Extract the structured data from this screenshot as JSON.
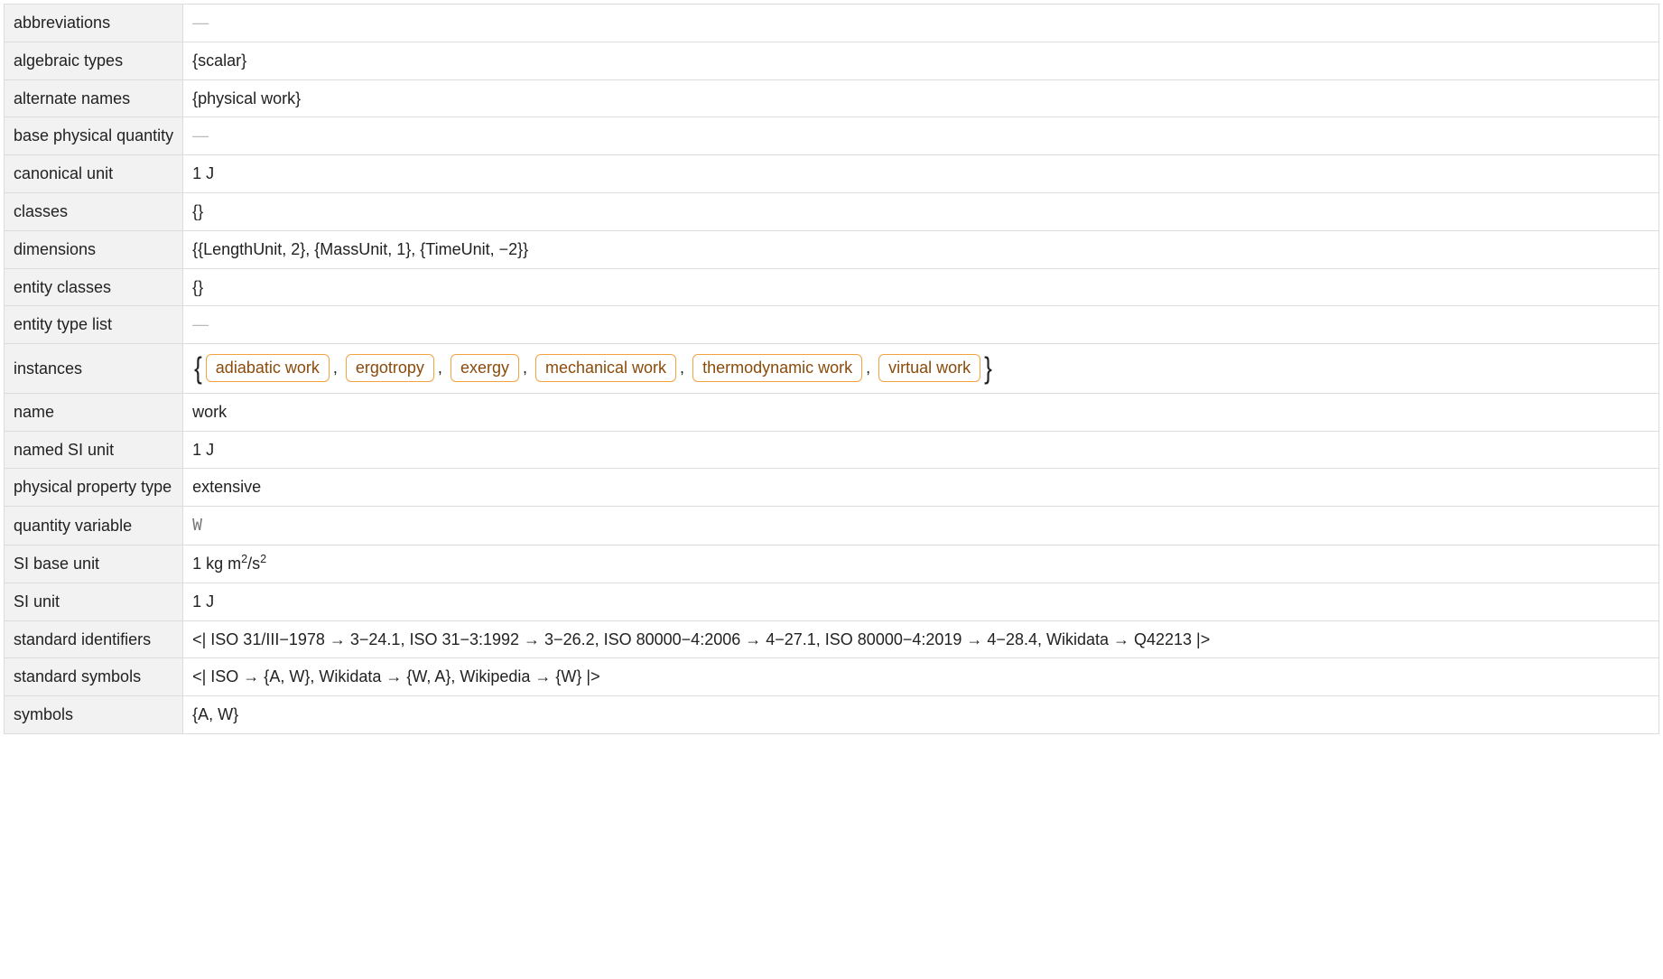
{
  "rows": [
    {
      "label": "abbreviations",
      "type": "missing"
    },
    {
      "label": "algebraic types",
      "type": "text",
      "value": "{scalar}"
    },
    {
      "label": "alternate names",
      "type": "text",
      "value": "{physical work}"
    },
    {
      "label": "base physical quantity",
      "type": "missing"
    },
    {
      "label": "canonical unit",
      "type": "text",
      "value": "1 J"
    },
    {
      "label": "classes",
      "type": "text",
      "value": "{}"
    },
    {
      "label": "dimensions",
      "type": "text",
      "value": "{{LengthUnit, 2}, {MassUnit, 1}, {TimeUnit, −2}}"
    },
    {
      "label": "entity classes",
      "type": "text",
      "value": "{}"
    },
    {
      "label": "entity type list",
      "type": "missing"
    },
    {
      "label": "instances",
      "type": "entities",
      "entities": [
        "adiabatic work",
        "ergotropy",
        "exergy",
        "mechanical work",
        "thermodynamic work",
        "virtual work"
      ]
    },
    {
      "label": "name",
      "type": "text",
      "value": "work"
    },
    {
      "label": "named SI unit",
      "type": "text",
      "value": "1 J"
    },
    {
      "label": "physical property type",
      "type": "text",
      "value": "extensive"
    },
    {
      "label": "quantity variable",
      "type": "code",
      "value": "W"
    },
    {
      "label": "SI base unit",
      "type": "html",
      "value": "1 kg m<sup>2</sup>/s<sup>2</sup>"
    },
    {
      "label": "SI unit",
      "type": "text",
      "value": "1 J"
    },
    {
      "label": "standard identifiers",
      "type": "text",
      "value": "<| ISO 31/III−1978 → 3−24.1, ISO 31−3:1992 → 3−26.2, ISO 80000−4:2006 → 4−27.1, ISO 80000−4:2019 → 4−28.4, Wikidata → Q42213 |>"
    },
    {
      "label": "standard symbols",
      "type": "text",
      "value": "<| ISO → {A, W}, Wikidata → {W, A}, Wikipedia → {W} |>"
    },
    {
      "label": "symbols",
      "type": "text",
      "value": "{A, W}"
    }
  ],
  "missing_glyph": "—"
}
